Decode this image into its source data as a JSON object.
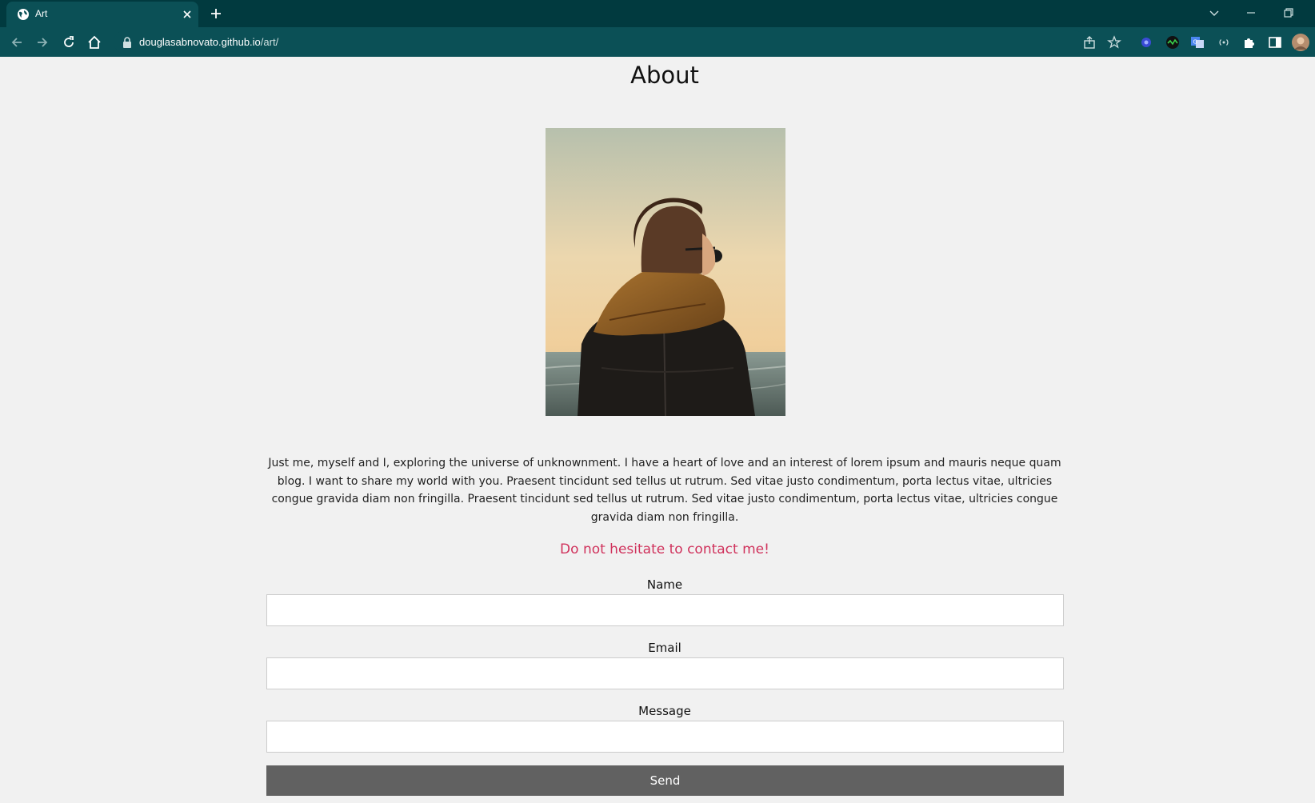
{
  "browser": {
    "tab_title": "Art",
    "url_host": "douglasabnovato.github.io",
    "url_path": "/art/"
  },
  "page": {
    "title": "About",
    "bio": "Just me, myself and I, exploring the universe of unknownment. I have a heart of love and an interest of lorem ipsum and mauris neque quam blog. I want to share my world with you. Praesent tincidunt sed tellus ut rutrum. Sed vitae justo condimentum, porta lectus vitae, ultricies congue gravida diam non fringilla. Praesent tincidunt sed tellus ut rutrum. Sed vitae justo condimentum, porta lectus vitae, ultricies congue gravida diam non fringilla.",
    "cta": "Do not hesitate to contact me!",
    "accent_color": "#d0325c"
  },
  "form": {
    "name_label": "Name",
    "name_value": "",
    "email_label": "Email",
    "email_value": "",
    "message_label": "Message",
    "message_value": "",
    "send_label": "Send"
  }
}
